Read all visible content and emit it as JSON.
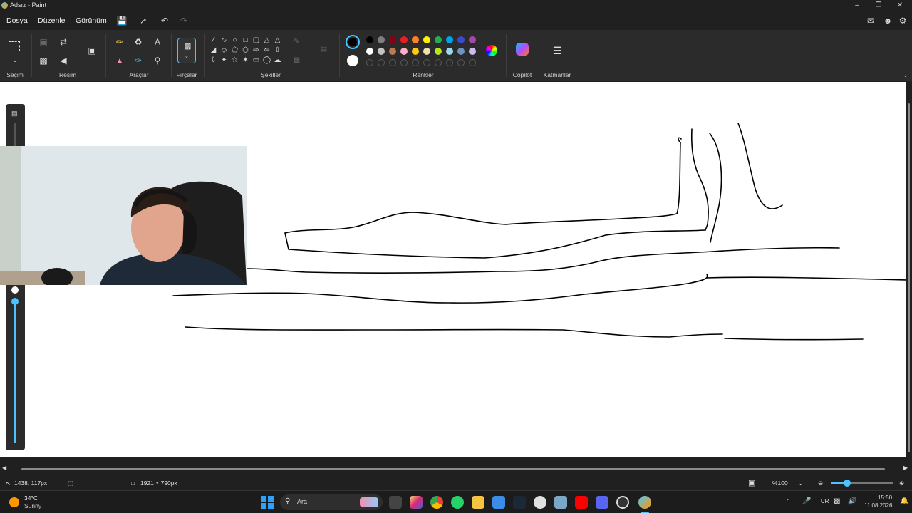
{
  "window": {
    "title": "Adsız - Paint"
  },
  "menu": {
    "file": "Dosya",
    "edit": "Düzenle",
    "view": "Görünüm"
  },
  "ribbon": {
    "selection_label": "Seçim",
    "image_label": "Resim",
    "tools_label": "Araçlar",
    "brushes_label": "Fırçalar",
    "shapes_label": "Şekiller",
    "colors_label": "Renkler",
    "copilot_label": "Copilot",
    "layers_label": "Katmanlar"
  },
  "colors": {
    "primary": "#000000",
    "secondary": "#ffffff",
    "row1": [
      "#000000",
      "#7f7f7f",
      "#880015",
      "#ed1c24",
      "#ff7f27",
      "#fff200",
      "#22b14c",
      "#00a2e8",
      "#3f48cc",
      "#a349a4"
    ],
    "row2": [
      "#ffffff",
      "#c3c3c3",
      "#b97a57",
      "#ffaec9",
      "#ffc90e",
      "#efe4b0",
      "#b5e61d",
      "#99d9ea",
      "#7092be",
      "#c8bfe7"
    ]
  },
  "status": {
    "cursor_position": "1438, 117px",
    "canvas_size": "1921 × 790px",
    "zoom": "%100",
    "zoom_level": 0.25
  },
  "taskbar": {
    "weather_temp": "34°C",
    "weather_desc": "Sunny",
    "search_placeholder": "Ara",
    "language": "TUR",
    "time": "15:50",
    "date": "11.08.2026"
  }
}
